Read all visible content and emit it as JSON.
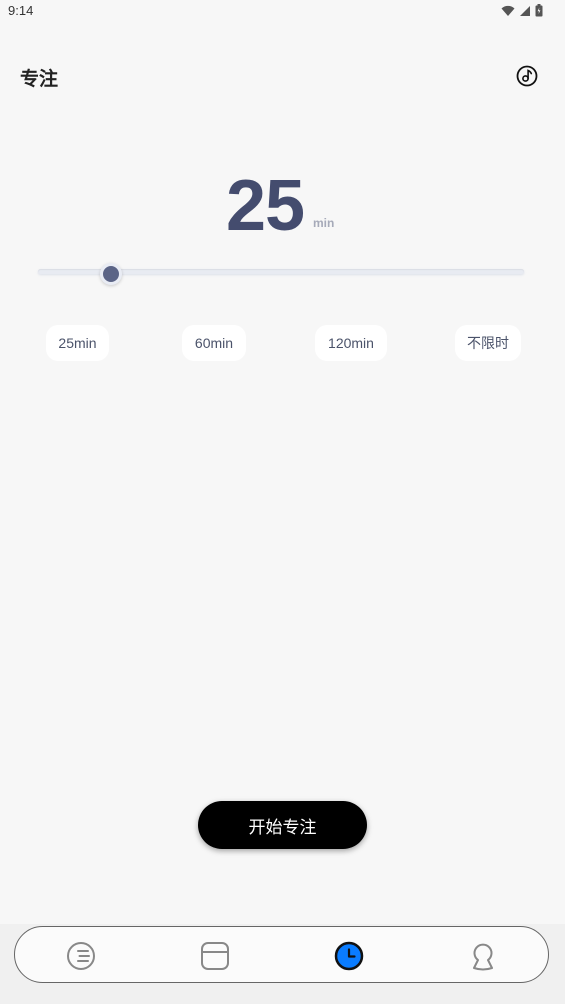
{
  "status_bar": {
    "time": "9:14",
    "icons": [
      "wifi-icon",
      "signal-icon",
      "battery-icon"
    ]
  },
  "header": {
    "title": "专注",
    "music_icon": "music-note-icon"
  },
  "timer": {
    "value": "25",
    "unit": "min"
  },
  "slider": {
    "level_percent": 15
  },
  "presets": [
    {
      "label": "25min",
      "selected": true
    },
    {
      "label": "60min",
      "selected": false
    },
    {
      "label": "120min",
      "selected": false
    },
    {
      "label": "不限时",
      "selected": false
    }
  ],
  "start_button": {
    "label": "开始专注"
  },
  "bottom_nav": {
    "items": [
      {
        "icon": "list-circle-icon",
        "active": false
      },
      {
        "icon": "calendar-icon",
        "active": false
      },
      {
        "icon": "clock-icon",
        "active": true
      },
      {
        "icon": "profile-icon",
        "active": false
      }
    ]
  },
  "colors": {
    "accent": "#0a7cff",
    "timer_text": "#444c6e",
    "button_bg": "#000000",
    "background": "#f7f7f7"
  }
}
